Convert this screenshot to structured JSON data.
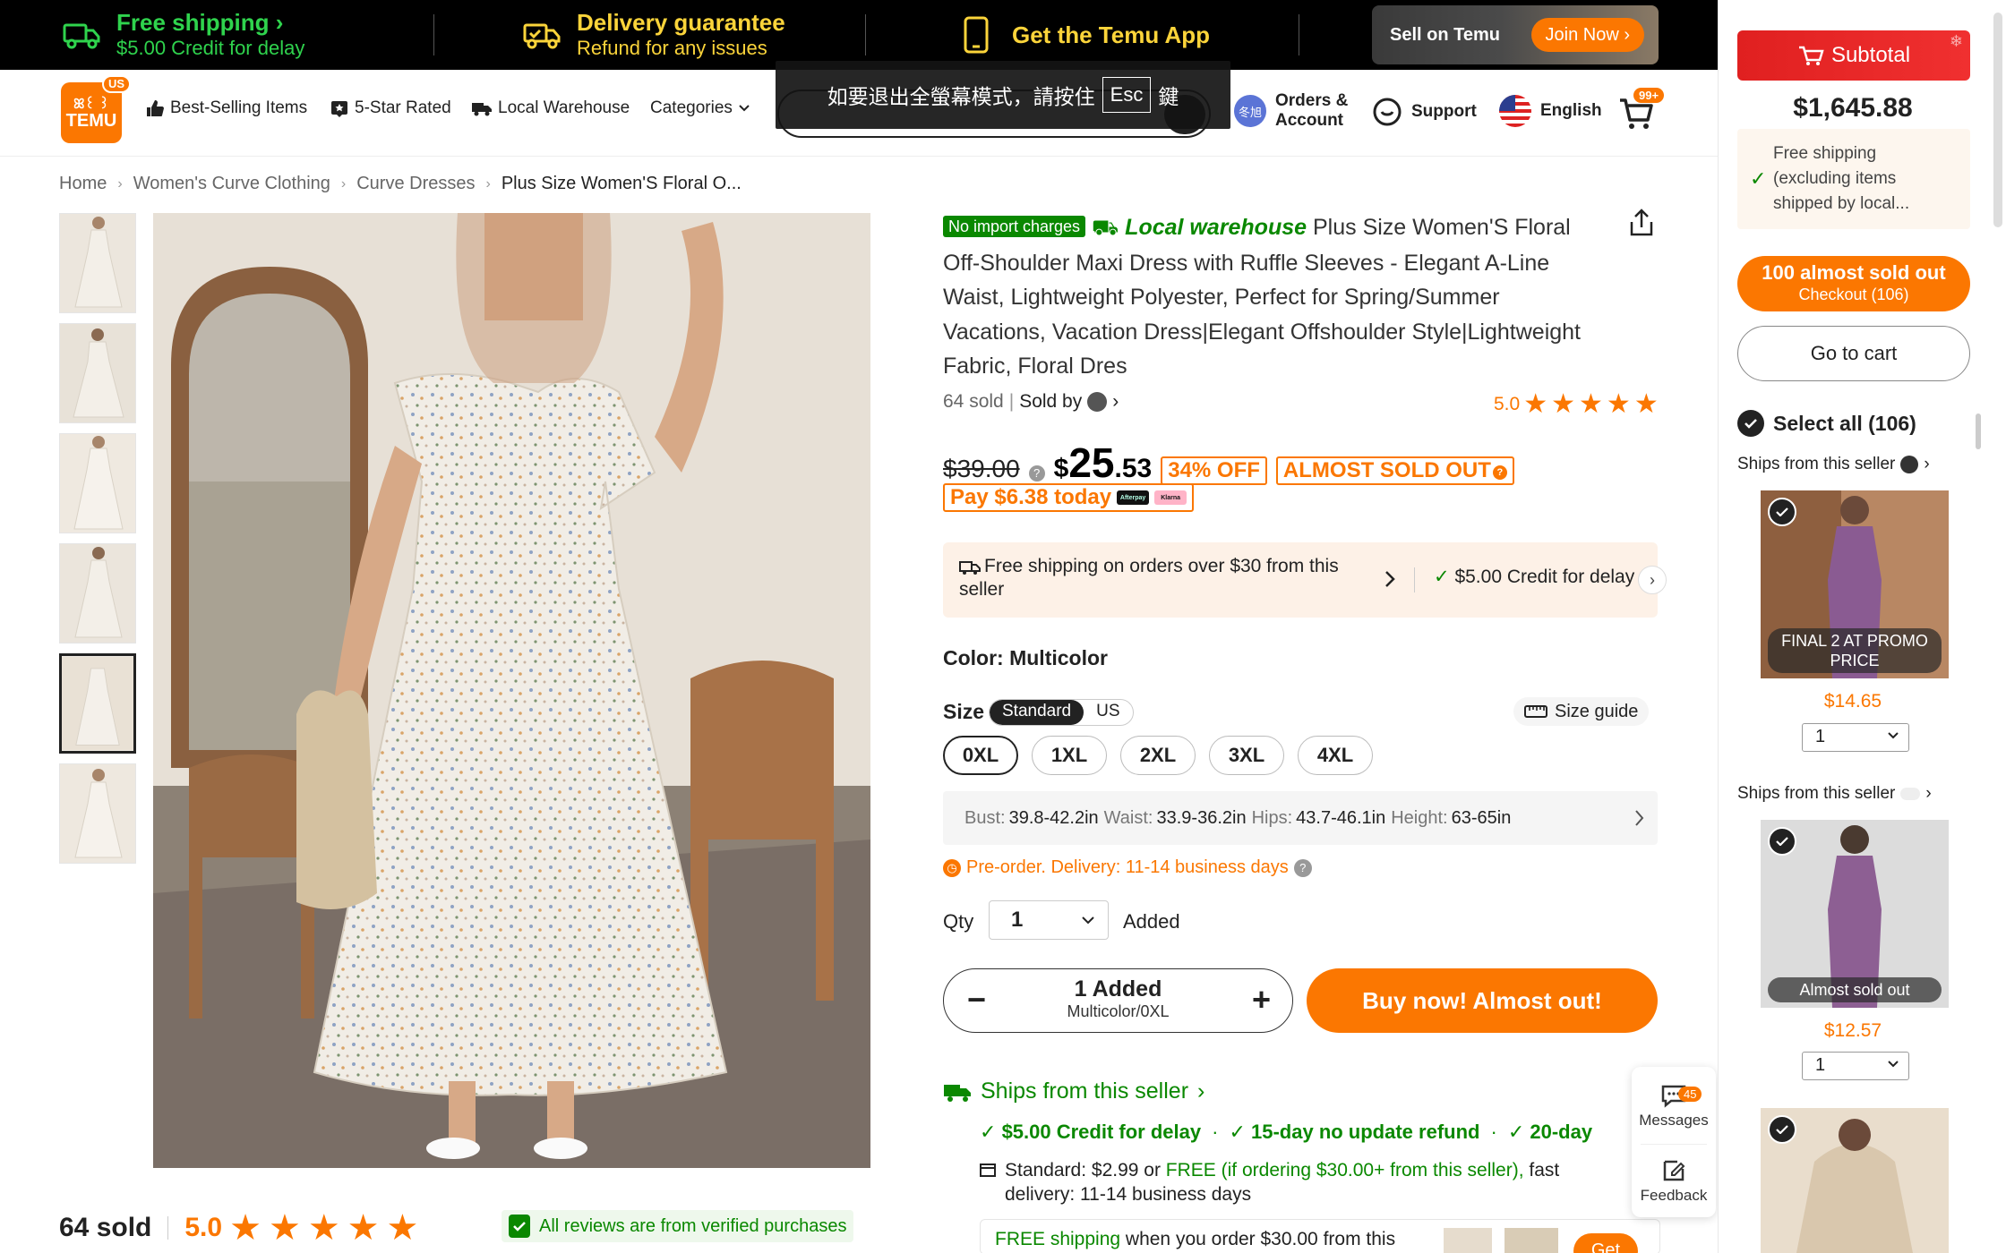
{
  "promo_bar": {
    "free_shipping_title": "Free shipping",
    "free_shipping_sub": "$5.00 Credit for delay",
    "delivery_title": "Delivery guarantee",
    "delivery_sub": "Refund for any issues",
    "app_label": "Get the Temu App",
    "sell_label": "Sell on Temu",
    "join_label": "Join Now"
  },
  "header": {
    "logo_text_top": "ꕤ꒰ ꒱",
    "logo_text": "TEMU",
    "logo_badge": "US",
    "nav": [
      "Best-Selling Items",
      "5-Star Rated",
      "Local Warehouse",
      "Categories"
    ],
    "fullscreen_tip_pre": "如要退出全螢幕模式，請按住",
    "fullscreen_tip_key": "Esc",
    "fullscreen_tip_post": "鍵",
    "orders_line1": "Orders &",
    "orders_line2": "Account",
    "avatar_text": "冬旭",
    "support": "Support",
    "language": "English",
    "cart_badge": "99+"
  },
  "breadcrumb": [
    "Home",
    "Women's Curve Clothing",
    "Curve Dresses",
    "Plus Size Women'S Floral O..."
  ],
  "product": {
    "no_import_tag": "No import charges",
    "local_warehouse": "Local warehouse",
    "title": "Plus Size Women'S Floral Off-Shoulder Maxi Dress with Ruffle Sleeves - Elegant A-Line Waist, Lightweight Polyester, Perfect for Spring/Summer Vacations, Vacation Dress|Elegant Offshoulder Style|Lightweight Fabric, Floral Dres",
    "sold_count": "64 sold",
    "sold_by": "Sold by",
    "rating": "5.0",
    "old_price": "$39.00",
    "price_dollar": "$",
    "price_main": "25",
    "price_cents": ".53",
    "discount_tag": "34% OFF",
    "almost_sold_tag": "ALMOST SOLD OUT",
    "pay_today": "Pay $6.38 today",
    "pay_icon1": "Afterpay",
    "pay_icon2": "Klarna",
    "ship_text": "Free shipping on orders over $30 from this seller",
    "credit_text": "$5.00 Credit for delay",
    "color_label": "Color: Multicolor",
    "size_label": "Size",
    "size_std": "Standard",
    "size_us": "US",
    "size_guide": "Size guide",
    "sizes": [
      "0XL",
      "1XL",
      "2XL",
      "3XL",
      "4XL"
    ],
    "measure": {
      "bust_k": "Bust:",
      "bust_v": "39.8-42.2in",
      "waist_k": "Waist:",
      "waist_v": "33.9-36.2in",
      "hips_k": "Hips:",
      "hips_v": "43.7-46.1in",
      "height_k": "Height:",
      "height_v": "63-65in"
    },
    "preorder": "Pre-order. Delivery: 11-14 business days",
    "qty_label": "Qty",
    "qty_value": "1",
    "added_label": "Added",
    "stepper_main": "1 Added",
    "stepper_sub": "Multicolor/0XL",
    "buy_now": "Buy now! Almost out!",
    "ships_from": "Ships from this seller",
    "perks": [
      "$5.00 Credit for delay",
      "15-day no update refund",
      "20-day"
    ],
    "std_ship_pre": "Standard: $2.99 or ",
    "std_ship_free": "FREE (if ordering $30.00+ from this seller),",
    "std_ship_post": " fast delivery: 11-14 business days",
    "free_bar_g": "FREE shipping",
    "free_bar_rest": " when you order $30.00 from this",
    "get_label": "Get"
  },
  "bottom": {
    "sold": "64 sold",
    "rating": "5.0",
    "verified": "All reviews are from verified purchases"
  },
  "widgets": {
    "messages": "Messages",
    "messages_badge": "45",
    "feedback": "Feedback"
  },
  "cart_panel": {
    "subtotal_label": "Subtotal",
    "subtotal_amount": "$1,645.88",
    "free_note": "Free shipping (excluding items shipped by local...",
    "checkout_main": "100 almost sold out",
    "checkout_sub": "Checkout (106)",
    "go_to_cart": "Go to cart",
    "select_all": "Select all (106)",
    "items": [
      {
        "ships": "Ships from this seller",
        "caption": "FINAL 2 AT PROMO PRICE",
        "price": "$14.65",
        "qty": "1"
      },
      {
        "ships": "Ships from this seller",
        "caption": "Almost sold out",
        "price": "$12.57",
        "qty": "1"
      }
    ]
  },
  "colors": {
    "accent": "#fb7701",
    "green": "#0a8800",
    "promo_green": "#2fd34d",
    "promo_yellow": "#fbd43a",
    "subtotal_red": "#e02020"
  }
}
